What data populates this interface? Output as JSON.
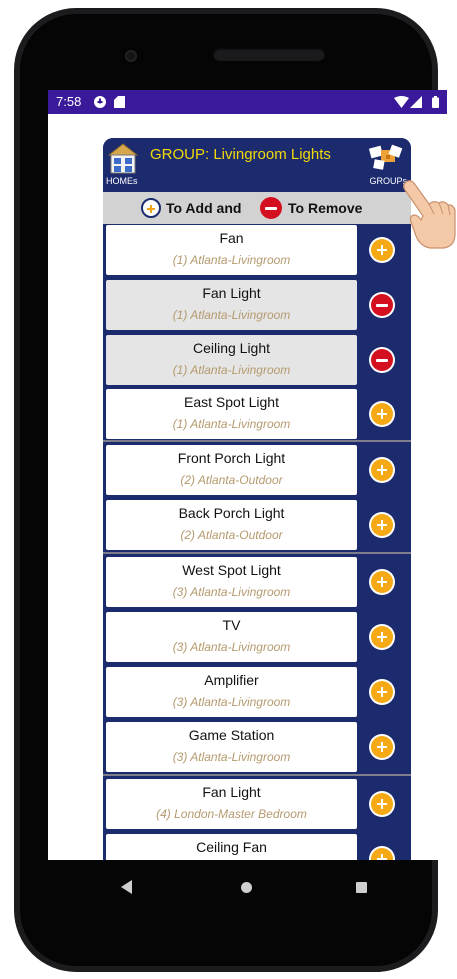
{
  "status_bar": {
    "time": "7:58"
  },
  "header": {
    "title": "GROUP: Livingroom Lights",
    "homes_label": "HOMEs",
    "groups_label": "GROUPs"
  },
  "legend": {
    "add_text": "To Add and",
    "remove_text": "To Remove"
  },
  "devices": [
    {
      "name": "Fan",
      "room": "(1) Atlanta-Livingroom",
      "action": "add"
    },
    {
      "name": "Fan Light",
      "room": "(1) Atlanta-Livingroom",
      "action": "remove"
    },
    {
      "name": "Ceiling Light",
      "room": "(1) Atlanta-Livingroom",
      "action": "remove"
    },
    {
      "name": "East Spot Light",
      "room": "(1) Atlanta-Livingroom",
      "action": "add"
    },
    {
      "name": "Front Porch Light",
      "room": "(2) Atlanta-Outdoor",
      "action": "add"
    },
    {
      "name": "Back Porch Light",
      "room": "(2) Atlanta-Outdoor",
      "action": "add"
    },
    {
      "name": "West Spot Light",
      "room": "(3) Atlanta-Livingroom",
      "action": "add"
    },
    {
      "name": "TV",
      "room": "(3) Atlanta-Livingroom",
      "action": "add"
    },
    {
      "name": "Amplifier",
      "room": "(3) Atlanta-Livingroom",
      "action": "add"
    },
    {
      "name": "Game Station",
      "room": "(3) Atlanta-Livingroom",
      "action": "add"
    },
    {
      "name": "Fan Light",
      "room": "(4) London-Master Bedroom",
      "action": "add"
    },
    {
      "name": "Ceiling Fan",
      "room": "",
      "action": "add"
    }
  ],
  "colors": {
    "header_bg": "#1c2b6e",
    "title": "#f2d90a",
    "status_bar": "#3a1a9a",
    "add": "#f5a914",
    "remove": "#d40f1f",
    "room_text": "#b59a6e"
  },
  "icons": {
    "homes": "house-icon",
    "groups": "groups-boxes-icon",
    "add": "plus-circle-icon",
    "remove": "minus-circle-icon",
    "pointer": "pointing-hand-icon"
  }
}
